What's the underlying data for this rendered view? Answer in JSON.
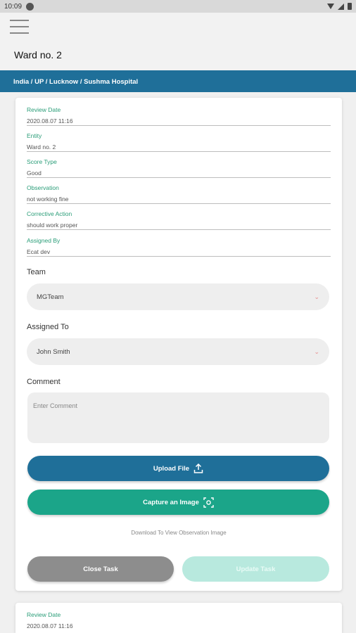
{
  "status_bar": {
    "time": "10:09"
  },
  "header": {
    "title": "Ward no. 2"
  },
  "breadcrumb": "India / UP / Lucknow / Sushma Hospital",
  "details": [
    {
      "label": "Review Date",
      "value": "2020.08.07 11:16"
    },
    {
      "label": "Entity",
      "value": "Ward no. 2"
    },
    {
      "label": "Score Type",
      "value": "Good"
    },
    {
      "label": "Observation",
      "value": "not working fine"
    },
    {
      "label": "Corrective Action",
      "value": "should work proper"
    },
    {
      "label": "Assigned By",
      "value": "Ecat dev"
    }
  ],
  "team": {
    "label": "Team",
    "selected": "MGTeam"
  },
  "assigned_to": {
    "label": "Assigned To",
    "selected": "John Smith"
  },
  "comment": {
    "label": "Comment",
    "placeholder": "Enter Comment"
  },
  "buttons": {
    "upload": "Upload File",
    "capture": "Capture an Image",
    "download_link": "Download To View Observation Image",
    "close": "Close Task",
    "update": "Update Task"
  },
  "next_card": {
    "label": "Review Date",
    "value": "2020.08.07 11:16"
  },
  "colors": {
    "primary": "#1f6f99",
    "accent": "#1ba589",
    "label_green": "#2a9d78"
  }
}
